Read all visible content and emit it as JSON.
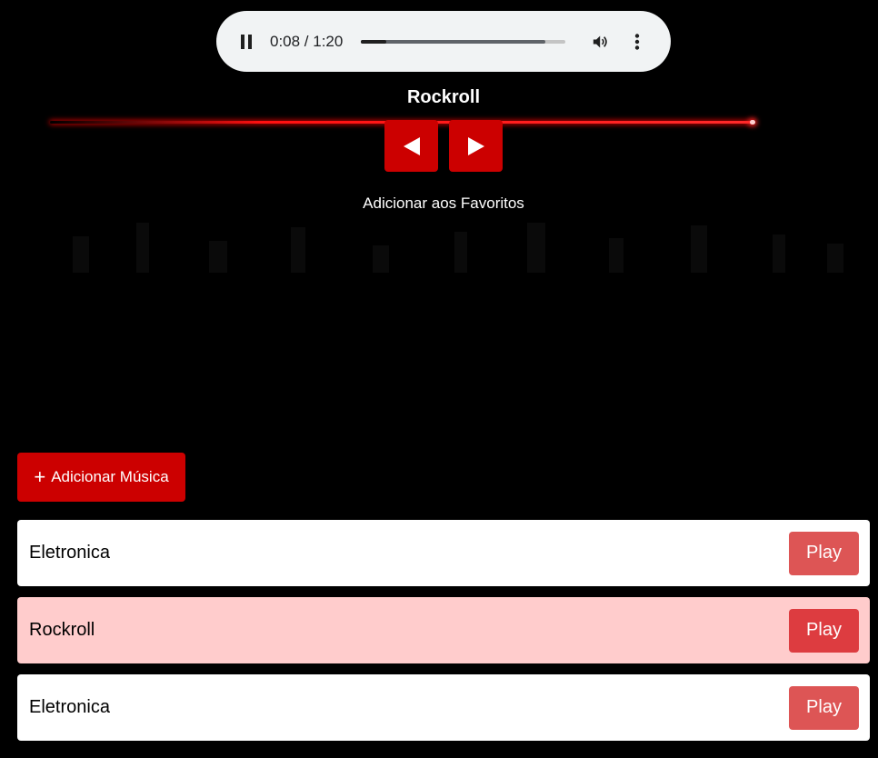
{
  "player": {
    "time_display": "0:08 / 1:20",
    "played_fraction": 0.125,
    "buffered_fraction": 0.9
  },
  "now_playing": {
    "title": "Rockroll"
  },
  "controls": {
    "favorites_label": "Adicionar aos Favoritos",
    "add_music_label": "Adicionar Música",
    "add_music_icon": "+"
  },
  "playlist": [
    {
      "name": "Eletronica",
      "play_label": "Play",
      "active": false
    },
    {
      "name": "Rockroll",
      "play_label": "Play",
      "active": true
    },
    {
      "name": "Eletronica",
      "play_label": "Play",
      "active": false
    }
  ],
  "colors": {
    "accent": "#cc0000",
    "active_row": "#ffcccc",
    "play_button": "#dd5555"
  }
}
